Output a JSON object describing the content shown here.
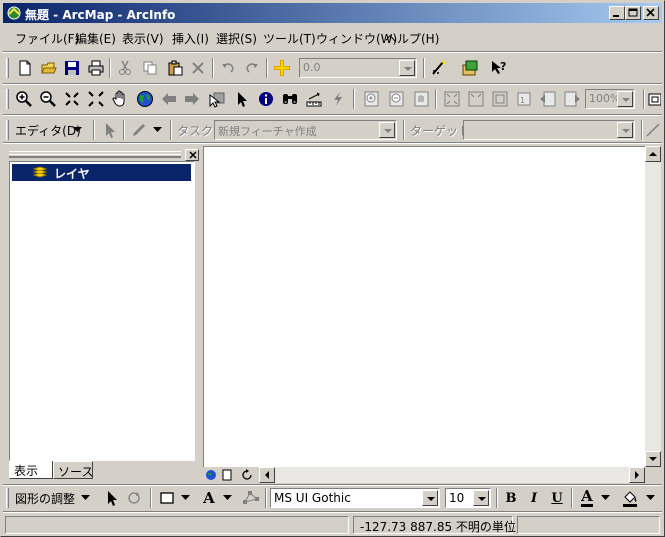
{
  "window": {
    "title": "無題 - ArcMap - ArcInfo"
  },
  "menu": [
    {
      "label": "ファイル(F)"
    },
    {
      "label": "編集(E)"
    },
    {
      "label": "表示(V)"
    },
    {
      "label": "挿入(I)"
    },
    {
      "label": "選択(S)"
    },
    {
      "label": "ツール(T)"
    },
    {
      "label": "ウィンドウ(W)"
    },
    {
      "label": "ヘルプ(H)"
    }
  ],
  "standard_toolbar": {
    "scale_value": "0.0"
  },
  "tools_toolbar": {
    "zoom_percent": "100%"
  },
  "editor_toolbar": {
    "editor_label": "エディタ(D)",
    "task_label": "タスク:",
    "task_value": "新規フィーチャ作成",
    "target_label": "ターゲット:",
    "target_value": ""
  },
  "toc": {
    "layer_name": "レイヤ",
    "tabs": [
      {
        "label": "表示"
      },
      {
        "label": "ソース"
      }
    ]
  },
  "draw_toolbar": {
    "drawing_label": "図形の調整",
    "font_name": "MS UI Gothic",
    "font_size": "10",
    "bold": "B",
    "italic": "I",
    "underline": "U",
    "text_a": "A",
    "font_color_a": "A"
  },
  "status": {
    "coordinates": "-127.73  887.85 不明の単位"
  }
}
